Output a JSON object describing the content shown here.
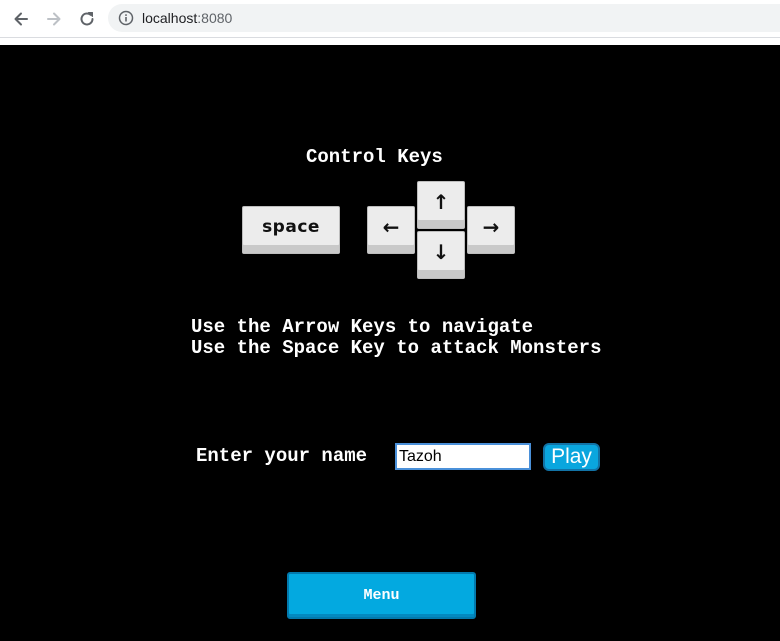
{
  "browser": {
    "url_host": "localhost",
    "url_port": ":8080"
  },
  "game": {
    "title": "Control Keys",
    "keys": {
      "space": "space",
      "up": "↑",
      "down": "↓",
      "left": "←",
      "right": "→"
    },
    "instructions": [
      "Use the Arrow Keys to navigate",
      "Use the Space Key to attack Monsters"
    ],
    "name_label": "Enter your name",
    "name_value": "Tazoh",
    "play_label": "Play",
    "menu_label": "Menu"
  },
  "colors": {
    "background": "#000000",
    "button_blue": "#03a9e0",
    "key_face": "#ececec"
  }
}
